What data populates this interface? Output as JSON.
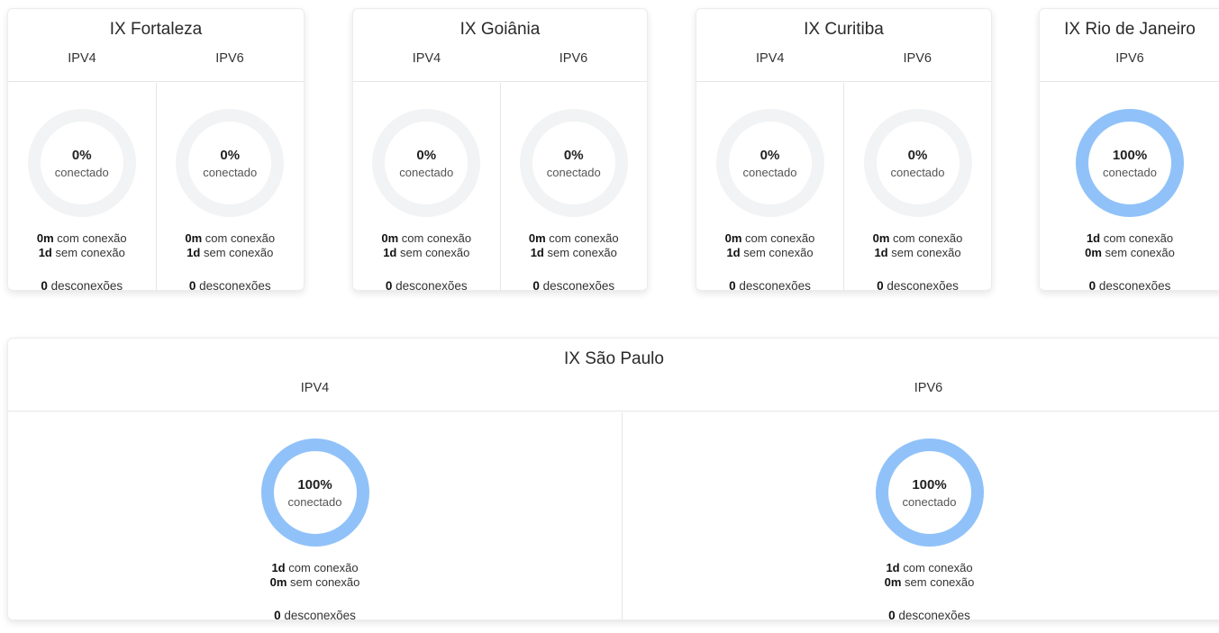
{
  "colors": {
    "connected": "#90c2f9",
    "track": "#f2f3f4"
  },
  "connected_label": "conectado",
  "with_connection_label": "com conexão",
  "without_connection_label": "sem conexão",
  "disconnections_label": "desconexões",
  "cards": {
    "fortaleza": {
      "title": "IX Fortaleza",
      "ipv4": {
        "label": "IPV4",
        "percent": 0,
        "percent_text": "0%",
        "with": "0m",
        "without": "1d",
        "disconnections": "0"
      },
      "ipv6": {
        "label": "IPV6",
        "percent": 0,
        "percent_text": "0%",
        "with": "0m",
        "without": "1d",
        "disconnections": "0"
      }
    },
    "goiania": {
      "title": "IX Goiânia",
      "ipv4": {
        "label": "IPV4",
        "percent": 0,
        "percent_text": "0%",
        "with": "0m",
        "without": "1d",
        "disconnections": "0"
      },
      "ipv6": {
        "label": "IPV6",
        "percent": 0,
        "percent_text": "0%",
        "with": "0m",
        "without": "1d",
        "disconnections": "0"
      }
    },
    "curitiba": {
      "title": "IX Curitiba",
      "ipv4": {
        "label": "IPV4",
        "percent": 0,
        "percent_text": "0%",
        "with": "0m",
        "without": "1d",
        "disconnections": "0"
      },
      "ipv6": {
        "label": "IPV6",
        "percent": 0,
        "percent_text": "0%",
        "with": "0m",
        "without": "1d",
        "disconnections": "0"
      }
    },
    "rio": {
      "title": "IX Rio de Janeiro",
      "ipv6": {
        "label": "IPV6",
        "percent": 100,
        "percent_text": "100%",
        "with": "1d",
        "without": "0m",
        "disconnections": "0"
      }
    },
    "saopaulo": {
      "title": "IX São Paulo",
      "ipv4": {
        "label": "IPV4",
        "percent": 100,
        "percent_text": "100%",
        "with": "1d",
        "without": "0m",
        "disconnections": "0"
      },
      "ipv6": {
        "label": "IPV6",
        "percent": 100,
        "percent_text": "100%",
        "with": "1d",
        "without": "0m",
        "disconnections": "0"
      }
    }
  }
}
